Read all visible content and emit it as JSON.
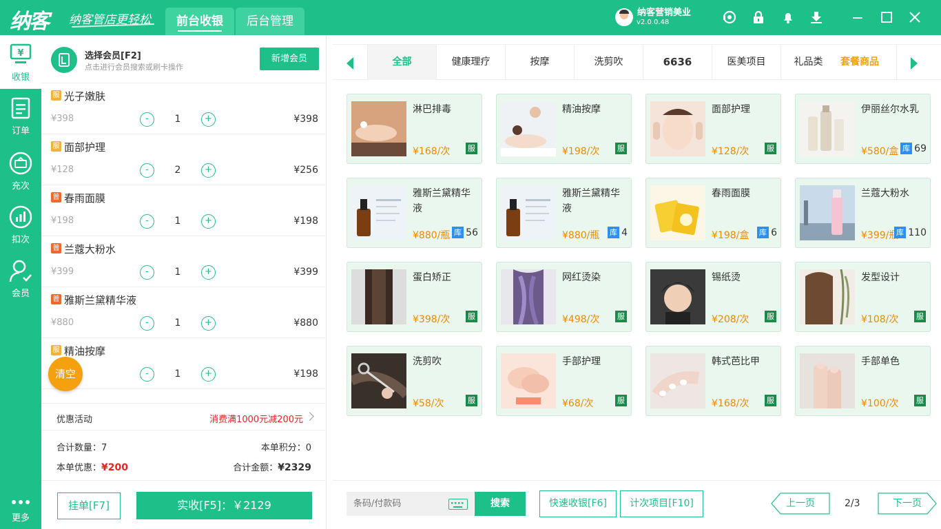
{
  "topbar": {
    "logo": "纳客",
    "slogan": "纳客管店更轻松",
    "tabs": [
      {
        "label": "前台收银"
      },
      {
        "label": "后台管理"
      }
    ],
    "user": {
      "name": "纳客营销美业",
      "version": "v2.0.0.48"
    },
    "icons": [
      "support-icon",
      "lock-icon",
      "bell-icon",
      "download-icon"
    ],
    "window": [
      "minimize",
      "maximize",
      "close"
    ]
  },
  "sidebar": {
    "items": [
      {
        "label": "收银",
        "icon": "cashier-icon"
      },
      {
        "label": "订单",
        "icon": "order-icon"
      },
      {
        "label": "充次",
        "icon": "recharge-icon"
      },
      {
        "label": "扣次",
        "icon": "deduct-icon"
      },
      {
        "label": "会员",
        "icon": "member-icon"
      }
    ],
    "more": "更多"
  },
  "cart": {
    "member_title": "选择会员[F2]",
    "member_sub": "点击进行会员搜索或刷卡操作",
    "new_member": "新增会员",
    "items": [
      {
        "tag": "服",
        "name": "光子嫩肤",
        "price": "¥398",
        "qty": "1",
        "subtotal": "¥398"
      },
      {
        "tag": "服",
        "name": "面部护理",
        "price": "¥128",
        "qty": "2",
        "subtotal": "¥256"
      },
      {
        "tag": "普",
        "name": "春雨面膜",
        "price": "¥198",
        "qty": "1",
        "subtotal": "¥198"
      },
      {
        "tag": "普",
        "name": "兰蔻大粉水",
        "price": "¥399",
        "qty": "1",
        "subtotal": "¥399"
      },
      {
        "tag": "普",
        "name": "雅斯兰黛精华液",
        "price": "¥880",
        "qty": "1",
        "subtotal": "¥880"
      },
      {
        "tag": "服",
        "name": "精油按摩",
        "price": "",
        "qty": "1",
        "subtotal": "¥198"
      }
    ],
    "minus": "-",
    "plus": "+",
    "clear": "清空",
    "promo_label": "优惠活动",
    "promo_value": "消费满1000元减200元",
    "total_qty_label": "合计数量：",
    "total_qty": "7",
    "points_label": "本单积分：",
    "points": "0",
    "discount_label": "本单优惠：",
    "discount": "¥200",
    "total_label": "合计金额：",
    "total": "¥2329",
    "hang": "挂单[F7]",
    "pay": "实收[F5]：￥2129"
  },
  "categories": {
    "items": [
      "全部",
      "健康理疗",
      "按摩",
      "洗剪吹",
      "6636",
      "医美项目",
      "礼品类"
    ],
    "combo": "套餐商品"
  },
  "products": [
    {
      "name": "淋巴排毒",
      "price": "¥168/次",
      "badge": "服",
      "stock": "",
      "img": "spa"
    },
    {
      "name": "精油按摩",
      "price": "¥198/次",
      "badge": "服",
      "stock": "",
      "img": "massage"
    },
    {
      "name": "面部护理",
      "price": "¥128/次",
      "badge": "服",
      "stock": "",
      "img": "face"
    },
    {
      "name": "伊丽丝尔水乳",
      "price": "¥580/盒",
      "badge": "库",
      "stock": "69",
      "img": "bottles"
    },
    {
      "name": "雅斯兰黛精华液",
      "price": "¥880/瓶",
      "badge": "库",
      "stock": "56",
      "img": "serum"
    },
    {
      "name": "雅斯兰黛精华液",
      "price": "¥880/瓶",
      "badge": "库",
      "stock": "4",
      "img": "serum"
    },
    {
      "name": "春雨面膜",
      "price": "¥198/盒",
      "badge": "库",
      "stock": "6",
      "img": "mask"
    },
    {
      "name": "兰蔻大粉水",
      "price": "¥399/瓶",
      "badge": "库",
      "stock": "110",
      "img": "toner"
    },
    {
      "name": "蛋白矫正",
      "price": "¥398/次",
      "badge": "服",
      "stock": "",
      "img": "hair-straight"
    },
    {
      "name": "网红烫染",
      "price": "¥498/次",
      "badge": "服",
      "stock": "",
      "img": "hair-purple"
    },
    {
      "name": "锡纸烫",
      "price": "¥208/次",
      "badge": "服",
      "stock": "",
      "img": "boy"
    },
    {
      "name": "发型设计",
      "price": "¥108/次",
      "badge": "服",
      "stock": "",
      "img": "hair-wave"
    },
    {
      "name": "洗剪吹",
      "price": "¥58/次",
      "badge": "服",
      "stock": "",
      "img": "scissors"
    },
    {
      "name": "手部护理",
      "price": "¥68/次",
      "badge": "服",
      "stock": "",
      "img": "hand-care"
    },
    {
      "name": "韩式芭比甲",
      "price": "¥168/次",
      "badge": "服",
      "stock": "",
      "img": "nails"
    },
    {
      "name": "手部单色",
      "price": "¥100/次",
      "badge": "服",
      "stock": "",
      "img": "nails2"
    }
  ],
  "bottom": {
    "scan_placeholder": "条码/付款码",
    "search": "搜索",
    "quick": "快速收银[F6]",
    "count_items": "计次项目[F10]",
    "prev": "上一页",
    "page": "2/3",
    "next": "下一页"
  },
  "colors": {
    "accent": "#1ec08a",
    "price": "#f08a00",
    "danger": "#ee2222",
    "clear": "#f5a10f"
  }
}
